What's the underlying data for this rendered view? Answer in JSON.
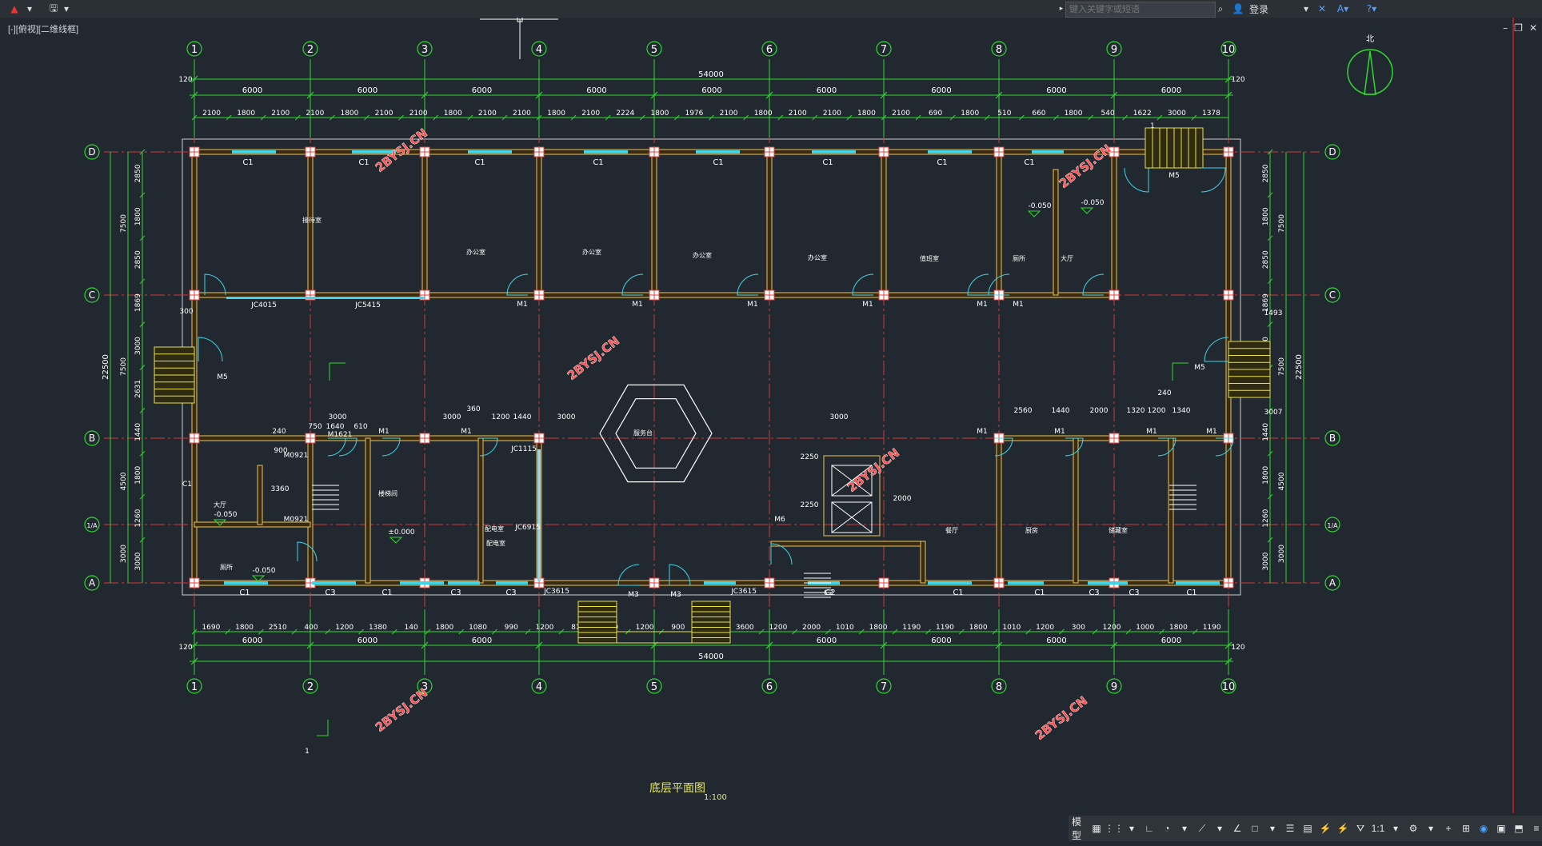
{
  "app": {
    "viewport_label": "[-][俯视][二维线框]",
    "search_placeholder": "键入关键字或短语",
    "login_label": "登录",
    "status_model": "模型",
    "status_scale": "1:1"
  },
  "drawing": {
    "title": "底层平面图",
    "scale": "1:100",
    "watermark": "2BYSJ.CN",
    "north_label": "北",
    "total_dim": "54000",
    "axes_top": [
      "1",
      "2",
      "3",
      "4",
      "5",
      "6",
      "7",
      "8",
      "9",
      "10"
    ],
    "axes_left": [
      "D",
      "C",
      "B",
      "1/A",
      "A"
    ],
    "bay_dims": [
      "6000",
      "6000",
      "6000",
      "6000",
      "6000",
      "6000",
      "6000",
      "6000",
      "6000"
    ],
    "side_dim_total": "22500",
    "top_sub_dims": [
      "2100",
      "1800",
      "2100",
      "2100",
      "1800",
      "2100",
      "2100",
      "1800",
      "2100",
      "2100",
      "1800",
      "2100",
      "2224",
      "1800",
      "1976",
      "2100",
      "1800",
      "2100",
      "2100",
      "1800",
      "2100",
      "690",
      "1800",
      "510",
      "660",
      "1800",
      "540",
      "1622",
      "3000",
      "1378"
    ],
    "bottom_sub_dims": [
      "1690",
      "1800",
      "2510",
      "400",
      "1200",
      "1380",
      "140",
      "1800",
      "1080",
      "990",
      "1200",
      "810",
      "900",
      "1200",
      "900",
      "1200",
      "3600",
      "1200",
      "2000",
      "1010",
      "1800",
      "1190",
      "1190",
      "1800",
      "1010",
      "1200",
      "300",
      "1200",
      "1000",
      "1800",
      "1190"
    ],
    "left_dims": [
      "2850",
      "1800",
      "2850",
      "1869",
      "3000",
      "2631",
      "1440",
      "1800",
      "1260",
      "3000"
    ],
    "left_totals": [
      "7500",
      "7500",
      "4500",
      "3000"
    ],
    "edge_dim": "120",
    "windows_top": [
      "C1",
      "C1",
      "C1",
      "C1",
      "C1",
      "C1",
      "C1",
      "C1"
    ],
    "windows_bottom": [
      "C1",
      "C3",
      "C1",
      "C3",
      "C3",
      "C2",
      "C1",
      "C1",
      "C3",
      "C3",
      "C1"
    ],
    "doors": [
      "M1",
      "M1",
      "M1",
      "M1",
      "M1",
      "M1",
      "M1",
      "M1",
      "M1",
      "M1",
      "M1",
      "M1",
      "M6"
    ],
    "other_labels": [
      "JC4015",
      "JC5415",
      "M5",
      "M5",
      "M5",
      "JC1115",
      "JC3615",
      "JC3615",
      "M3",
      "M3",
      "JC6915",
      "M1621",
      "M0921",
      "M0921",
      "C1",
      "C2",
      "3000",
      "3000",
      "3000",
      "3000",
      "360",
      "1200",
      "1440",
      "750",
      "1640",
      "610",
      "2560",
      "1440",
      "2000",
      "1320",
      "1200",
      "1340",
      "240",
      "2250",
      "2250",
      "2000",
      "3360",
      "900",
      "240",
      "300",
      "1493",
      "3007",
      "1",
      "1"
    ],
    "levels": [
      "-0.050",
      "-0.050",
      "-0.050",
      "-0.050",
      "±0.000"
    ],
    "rooms": [
      "接待室",
      "办公室",
      "办公室",
      "办公室",
      "办公室",
      "值班室",
      "厕所",
      "大厅",
      "厕所",
      "服务台",
      "餐厅",
      "配电室",
      "配电室",
      "厨房",
      "储藏室",
      "楼梯间",
      "大厅"
    ]
  }
}
